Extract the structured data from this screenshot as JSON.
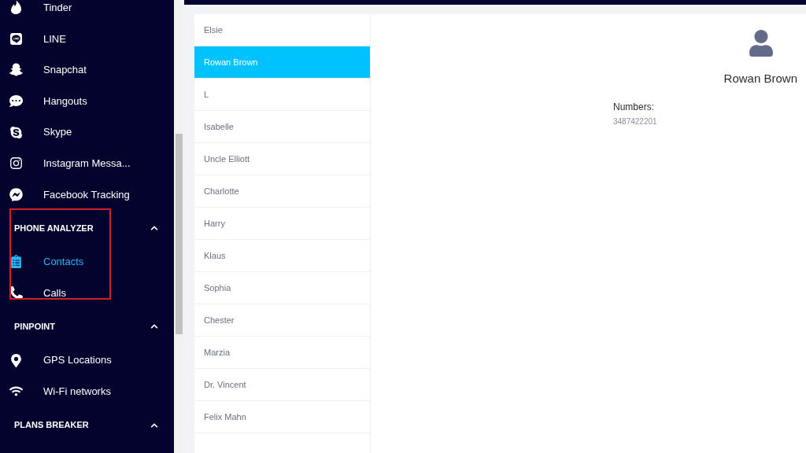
{
  "sidebar": {
    "sections": [
      {
        "items": [
          {
            "label": "Tinder",
            "selected": false
          },
          {
            "label": "LINE",
            "selected": false
          },
          {
            "label": "Snapchat",
            "selected": false
          },
          {
            "label": "Hangouts",
            "selected": false
          },
          {
            "label": "Skype",
            "selected": false
          },
          {
            "label": "Instagram Messa...",
            "selected": false
          },
          {
            "label": "Facebook Tracking",
            "selected": false
          }
        ]
      },
      {
        "title": "PHONE ANALYZER",
        "expanded": true,
        "highlighted": true,
        "items": [
          {
            "label": "Contacts",
            "selected": true
          },
          {
            "label": "Calls",
            "selected": false
          }
        ]
      },
      {
        "title": "PINPOINT",
        "expanded": true,
        "highlighted": false,
        "items": [
          {
            "label": "GPS Locations",
            "selected": false
          },
          {
            "label": "Wi-Fi networks",
            "selected": false
          }
        ]
      },
      {
        "title": "PLANS BREAKER",
        "expanded": true,
        "highlighted": false
      }
    ]
  },
  "contacts": [
    {
      "name": "Elsie",
      "selected": false
    },
    {
      "name": "Rowan Brown",
      "selected": true
    },
    {
      "name": "L",
      "selected": false
    },
    {
      "name": "Isabelle",
      "selected": false
    },
    {
      "name": "Uncle Elliott",
      "selected": false
    },
    {
      "name": "Charlotte",
      "selected": false
    },
    {
      "name": "Harry",
      "selected": false
    },
    {
      "name": "Klaus",
      "selected": false
    },
    {
      "name": "Sophia",
      "selected": false
    },
    {
      "name": "Chester",
      "selected": false
    },
    {
      "name": "Marzia",
      "selected": false
    },
    {
      "name": "Dr. Vincent",
      "selected": false
    },
    {
      "name": "Felix Mahn",
      "selected": false
    }
  ],
  "detail": {
    "name": "Rowan Brown",
    "numbers_label": "Numbers:",
    "numbers": [
      "3487422201"
    ]
  }
}
